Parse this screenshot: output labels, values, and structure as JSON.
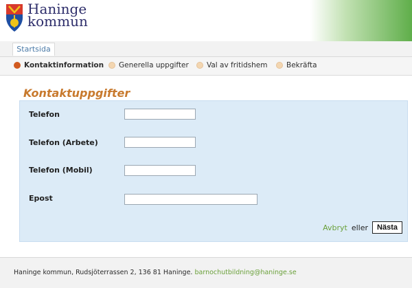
{
  "header": {
    "brand_line1": "Haninge",
    "brand_line2": "kommun"
  },
  "nav": {
    "tab_label": "Startsida"
  },
  "steps": [
    {
      "label": "Kontaktinformation",
      "status": "active"
    },
    {
      "label": "Generella uppgifter",
      "status": "pending"
    },
    {
      "label": "Val av fritidshem",
      "status": "pending"
    },
    {
      "label": "Bekräfta",
      "status": "pending"
    }
  ],
  "form": {
    "title": "Kontaktuppgifter",
    "fields": [
      {
        "label": "Telefon",
        "value": ""
      },
      {
        "label": "Telefon (Arbete)",
        "value": ""
      },
      {
        "label": "Telefon (Mobil)",
        "value": ""
      },
      {
        "label": "Epost",
        "value": ""
      }
    ],
    "cancel_label": "Avbryt",
    "or_label": "eller",
    "next_label": "Nästa"
  },
  "footer": {
    "text": "Haninge kommun, Rudsjöterrassen 2, 136 81 Haninge.",
    "email": "barnochutbildning@haninge.se"
  },
  "colors": {
    "accent_orange": "#d15a1f",
    "title_orange": "#c87a2e",
    "link_green": "#6aa03a",
    "panel_blue": "#dcebf7"
  },
  "icons": {
    "logo": "municipal-shield-icon",
    "step_marker": "circle-icon"
  }
}
